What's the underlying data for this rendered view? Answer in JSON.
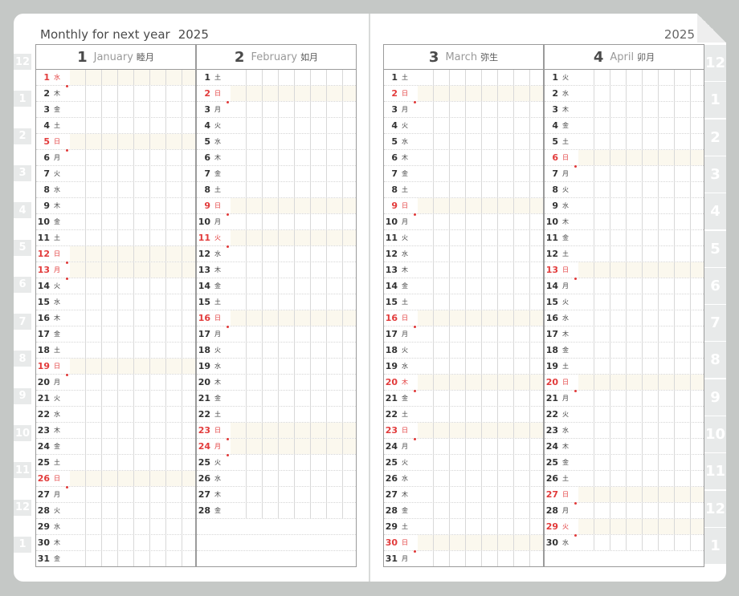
{
  "left_heading": {
    "title": "Monthly for next year",
    "year": "2025"
  },
  "right_heading": {
    "year": "2025"
  },
  "left_tabs": [
    "12",
    "1",
    "2",
    "3",
    "4",
    "5",
    "6",
    "7",
    "8",
    "9",
    "10",
    "11",
    "12",
    "1"
  ],
  "right_tabs": [
    "12",
    "1",
    "2",
    "3",
    "4",
    "5",
    "6",
    "7",
    "8",
    "9",
    "10",
    "11",
    "12",
    "1"
  ],
  "active_tab": {
    "side": "right",
    "index": 13
  },
  "colors": {
    "holiday": "#e23b3b",
    "tab_active": "#f3c3bd",
    "frame": "#c5c8c6"
  },
  "months": [
    {
      "num": "1",
      "name": "January",
      "jp": "睦月",
      "days": [
        {
          "d": "1",
          "w": "水",
          "h": true
        },
        {
          "d": "2",
          "w": "木"
        },
        {
          "d": "3",
          "w": "金"
        },
        {
          "d": "4",
          "w": "土"
        },
        {
          "d": "5",
          "w": "日",
          "h": true
        },
        {
          "d": "6",
          "w": "月"
        },
        {
          "d": "7",
          "w": "火"
        },
        {
          "d": "8",
          "w": "水"
        },
        {
          "d": "9",
          "w": "木"
        },
        {
          "d": "10",
          "w": "金"
        },
        {
          "d": "11",
          "w": "土"
        },
        {
          "d": "12",
          "w": "日",
          "h": true
        },
        {
          "d": "13",
          "w": "月",
          "h": true
        },
        {
          "d": "14",
          "w": "火"
        },
        {
          "d": "15",
          "w": "水"
        },
        {
          "d": "16",
          "w": "木"
        },
        {
          "d": "17",
          "w": "金"
        },
        {
          "d": "18",
          "w": "土"
        },
        {
          "d": "19",
          "w": "日",
          "h": true
        },
        {
          "d": "20",
          "w": "月"
        },
        {
          "d": "21",
          "w": "火"
        },
        {
          "d": "22",
          "w": "水"
        },
        {
          "d": "23",
          "w": "木"
        },
        {
          "d": "24",
          "w": "金"
        },
        {
          "d": "25",
          "w": "土"
        },
        {
          "d": "26",
          "w": "日",
          "h": true
        },
        {
          "d": "27",
          "w": "月"
        },
        {
          "d": "28",
          "w": "火"
        },
        {
          "d": "29",
          "w": "水"
        },
        {
          "d": "30",
          "w": "木"
        },
        {
          "d": "31",
          "w": "金"
        }
      ]
    },
    {
      "num": "2",
      "name": "February",
      "jp": "如月",
      "days": [
        {
          "d": "1",
          "w": "土"
        },
        {
          "d": "2",
          "w": "日",
          "h": true
        },
        {
          "d": "3",
          "w": "月"
        },
        {
          "d": "4",
          "w": "火"
        },
        {
          "d": "5",
          "w": "水"
        },
        {
          "d": "6",
          "w": "木"
        },
        {
          "d": "7",
          "w": "金"
        },
        {
          "d": "8",
          "w": "土"
        },
        {
          "d": "9",
          "w": "日",
          "h": true
        },
        {
          "d": "10",
          "w": "月"
        },
        {
          "d": "11",
          "w": "火",
          "h": true
        },
        {
          "d": "12",
          "w": "水"
        },
        {
          "d": "13",
          "w": "木"
        },
        {
          "d": "14",
          "w": "金"
        },
        {
          "d": "15",
          "w": "土"
        },
        {
          "d": "16",
          "w": "日",
          "h": true
        },
        {
          "d": "17",
          "w": "月"
        },
        {
          "d": "18",
          "w": "火"
        },
        {
          "d": "19",
          "w": "水"
        },
        {
          "d": "20",
          "w": "木"
        },
        {
          "d": "21",
          "w": "金"
        },
        {
          "d": "22",
          "w": "土"
        },
        {
          "d": "23",
          "w": "日",
          "h": true
        },
        {
          "d": "24",
          "w": "月",
          "h": true
        },
        {
          "d": "25",
          "w": "火"
        },
        {
          "d": "26",
          "w": "水"
        },
        {
          "d": "27",
          "w": "木"
        },
        {
          "d": "28",
          "w": "金"
        }
      ]
    },
    {
      "num": "3",
      "name": "March",
      "jp": "弥生",
      "days": [
        {
          "d": "1",
          "w": "土"
        },
        {
          "d": "2",
          "w": "日",
          "h": true
        },
        {
          "d": "3",
          "w": "月"
        },
        {
          "d": "4",
          "w": "火"
        },
        {
          "d": "5",
          "w": "水"
        },
        {
          "d": "6",
          "w": "木"
        },
        {
          "d": "7",
          "w": "金"
        },
        {
          "d": "8",
          "w": "土"
        },
        {
          "d": "9",
          "w": "日",
          "h": true
        },
        {
          "d": "10",
          "w": "月"
        },
        {
          "d": "11",
          "w": "火"
        },
        {
          "d": "12",
          "w": "水"
        },
        {
          "d": "13",
          "w": "木"
        },
        {
          "d": "14",
          "w": "金"
        },
        {
          "d": "15",
          "w": "土"
        },
        {
          "d": "16",
          "w": "日",
          "h": true
        },
        {
          "d": "17",
          "w": "月"
        },
        {
          "d": "18",
          "w": "火"
        },
        {
          "d": "19",
          "w": "水"
        },
        {
          "d": "20",
          "w": "木",
          "h": true
        },
        {
          "d": "21",
          "w": "金"
        },
        {
          "d": "22",
          "w": "土"
        },
        {
          "d": "23",
          "w": "日",
          "h": true
        },
        {
          "d": "24",
          "w": "月"
        },
        {
          "d": "25",
          "w": "火"
        },
        {
          "d": "26",
          "w": "水"
        },
        {
          "d": "27",
          "w": "木"
        },
        {
          "d": "28",
          "w": "金"
        },
        {
          "d": "29",
          "w": "土"
        },
        {
          "d": "30",
          "w": "日",
          "h": true
        },
        {
          "d": "31",
          "w": "月"
        }
      ]
    },
    {
      "num": "4",
      "name": "April",
      "jp": "卯月",
      "days": [
        {
          "d": "1",
          "w": "火"
        },
        {
          "d": "2",
          "w": "水"
        },
        {
          "d": "3",
          "w": "木"
        },
        {
          "d": "4",
          "w": "金"
        },
        {
          "d": "5",
          "w": "土"
        },
        {
          "d": "6",
          "w": "日",
          "h": true
        },
        {
          "d": "7",
          "w": "月"
        },
        {
          "d": "8",
          "w": "火"
        },
        {
          "d": "9",
          "w": "水"
        },
        {
          "d": "10",
          "w": "木"
        },
        {
          "d": "11",
          "w": "金"
        },
        {
          "d": "12",
          "w": "土"
        },
        {
          "d": "13",
          "w": "日",
          "h": true
        },
        {
          "d": "14",
          "w": "月"
        },
        {
          "d": "15",
          "w": "火"
        },
        {
          "d": "16",
          "w": "水"
        },
        {
          "d": "17",
          "w": "木"
        },
        {
          "d": "18",
          "w": "金"
        },
        {
          "d": "19",
          "w": "土"
        },
        {
          "d": "20",
          "w": "日",
          "h": true
        },
        {
          "d": "21",
          "w": "月"
        },
        {
          "d": "22",
          "w": "火"
        },
        {
          "d": "23",
          "w": "水"
        },
        {
          "d": "24",
          "w": "木"
        },
        {
          "d": "25",
          "w": "金"
        },
        {
          "d": "26",
          "w": "土"
        },
        {
          "d": "27",
          "w": "日",
          "h": true
        },
        {
          "d": "28",
          "w": "月"
        },
        {
          "d": "29",
          "w": "火",
          "h": true
        },
        {
          "d": "30",
          "w": "水"
        }
      ]
    }
  ]
}
